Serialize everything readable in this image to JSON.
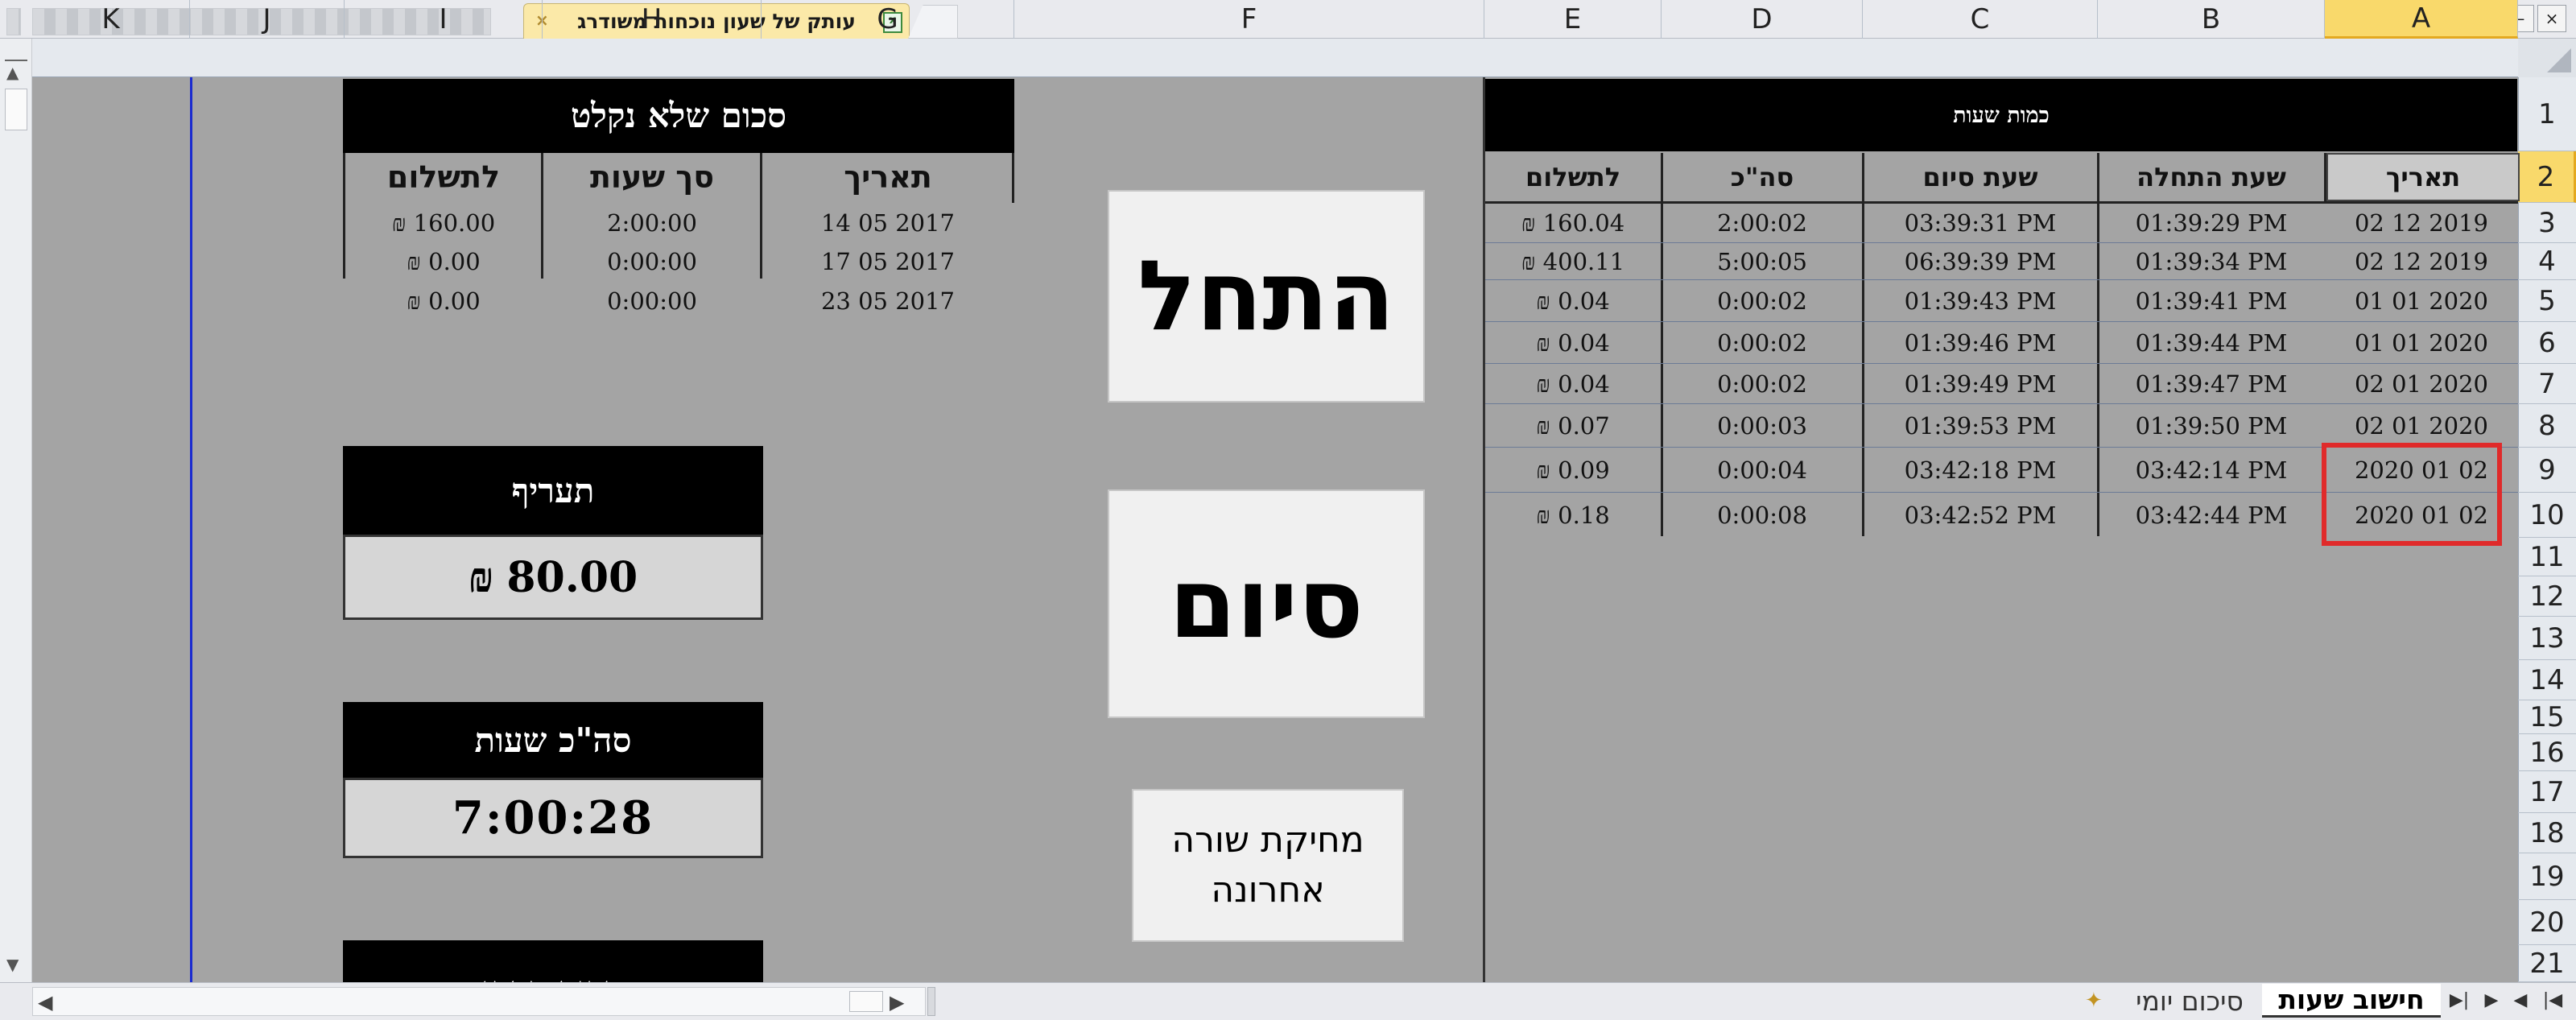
{
  "window": {
    "active_tab_title": "עותק של שעון נוכחות משודרג",
    "tab_close_glyph": "×",
    "minimize_glyph": "‒",
    "close_glyph": "×"
  },
  "columns": [
    "A",
    "B",
    "C",
    "D",
    "E",
    "F",
    "G",
    "H",
    "I",
    "J",
    "K"
  ],
  "selected_column": "A",
  "rows": [
    "1",
    "2",
    "3",
    "4",
    "5",
    "6",
    "7",
    "8",
    "9",
    "10",
    "11",
    "12",
    "13",
    "14",
    "15",
    "16",
    "17",
    "18",
    "19",
    "20",
    "21"
  ],
  "selected_row": "2",
  "hours_table": {
    "title": "כמות שעות",
    "headers": [
      "תאריך",
      "שעת התחלה",
      "שעת סיום",
      "סה\"כ",
      "לתשלום"
    ],
    "rows": [
      {
        "date": "02 12 2019",
        "start": "01:39:29 PM",
        "end": "03:39:31 PM",
        "total": "2:00:02",
        "pay": "₪ 160.04"
      },
      {
        "date": "02 12 2019",
        "start": "01:39:34 PM",
        "end": "06:39:39 PM",
        "total": "5:00:05",
        "pay": "₪ 400.11"
      },
      {
        "date": "01 01 2020",
        "start": "01:39:41 PM",
        "end": "01:39:43 PM",
        "total": "0:00:02",
        "pay": "₪ 0.04"
      },
      {
        "date": "01 01 2020",
        "start": "01:39:44 PM",
        "end": "01:39:46 PM",
        "total": "0:00:02",
        "pay": "₪ 0.04"
      },
      {
        "date": "02 01 2020",
        "start": "01:39:47 PM",
        "end": "01:39:49 PM",
        "total": "0:00:02",
        "pay": "₪ 0.04"
      },
      {
        "date": "02 01 2020",
        "start": "01:39:50 PM",
        "end": "01:39:53 PM",
        "total": "0:00:03",
        "pay": "₪ 0.07"
      },
      {
        "date": "2020 01 02",
        "start": "03:42:14 PM",
        "end": "03:42:18 PM",
        "total": "0:00:04",
        "pay": "₪ 0.09"
      },
      {
        "date": "2020 01 02",
        "start": "03:42:44 PM",
        "end": "03:42:52 PM",
        "total": "0:00:08",
        "pay": "₪ 0.18"
      }
    ]
  },
  "buttons": {
    "start": "התחל",
    "end": "סיום",
    "delete_last_row": "מחיקת שורה אחרונה"
  },
  "uncollected_summary": {
    "title": "סכום שלא נקלט",
    "headers": [
      "תאריך",
      "סך שעות",
      "לתשלום"
    ],
    "rows": [
      {
        "date": "14 05 2017",
        "hours": "2:00:00",
        "pay": "₪ 160.00"
      },
      {
        "date": "17 05 2017",
        "hours": "0:00:00",
        "pay": "₪ 0.00"
      },
      {
        "date": "23 05 2017",
        "hours": "0:00:00",
        "pay": "₪ 0.00"
      }
    ]
  },
  "rate_box": {
    "title": "תעריף",
    "value": "80.00",
    "currency": "₪"
  },
  "total_hours_box": {
    "title": "סה\"כ שעות",
    "value": "7:00:28"
  },
  "partial_box": {
    "title": "סכום כספי"
  },
  "sheet_tabs": {
    "active": "חישוב שעות",
    "second": "סיכום יומי"
  },
  "colors": {
    "highlight_box": "#e02a2a",
    "selected_header": "#f9d96b",
    "sheet_bg": "#a4a4a4"
  }
}
